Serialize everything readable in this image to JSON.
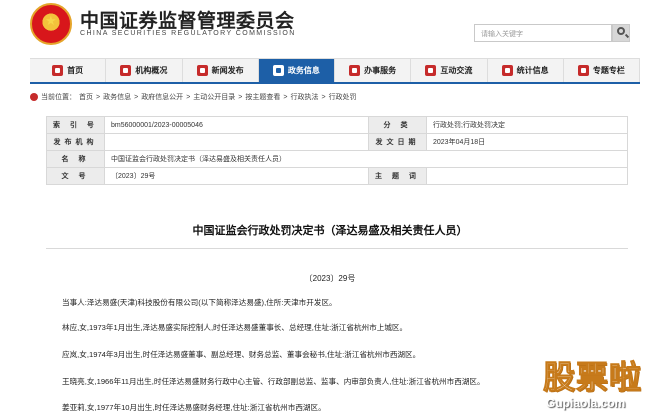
{
  "header": {
    "title": "中国证券监督管理委员会",
    "subtitle": "CHINA SECURITIES REGULATORY COMMISSION",
    "search_placeholder": "请输入关键字"
  },
  "nav": [
    {
      "label": "首页",
      "icon": "home-icon",
      "active": false
    },
    {
      "label": "机构概况",
      "icon": "building-icon",
      "active": false
    },
    {
      "label": "新闻发布",
      "icon": "news-icon",
      "active": false
    },
    {
      "label": "政务信息",
      "icon": "document-icon",
      "active": true
    },
    {
      "label": "办事服务",
      "icon": "service-icon",
      "active": false
    },
    {
      "label": "互动交流",
      "icon": "chat-icon",
      "active": false
    },
    {
      "label": "统计信息",
      "icon": "chart-icon",
      "active": false
    },
    {
      "label": "专题专栏",
      "icon": "folder-icon",
      "active": false
    }
  ],
  "breadcrumb": {
    "prefix": "当前位置：",
    "items": [
      "首页",
      "政务信息",
      "政府信息公开",
      "主动公开目录",
      "按主题查看",
      "行政执法",
      "行政处罚"
    ],
    "separator": ">"
  },
  "meta": {
    "index_label": "索 引 号",
    "index_value": "bm56000001/2023-00005046",
    "category_label": "分 类",
    "category_value": "行政处罚;行政处罚决定",
    "issuer_label": "发布机构",
    "issuer_value": "",
    "date_label": "发文日期",
    "date_value": "2023年04月18日",
    "name_label": "名 称",
    "name_value": "中国证监会行政处罚决定书（泽达易盛及相关责任人员）",
    "docno_label": "文 号",
    "docno_value": "〔2023〕29号",
    "keywords_label": "主 题 词",
    "keywords_value": ""
  },
  "document": {
    "title": "中国证监会行政处罚决定书（泽达易盛及相关责任人员）",
    "number": "〔2023〕29号",
    "paragraphs": [
      "当事人:泽达易盛(天津)科技股份有限公司(以下简称泽达易盛),住所:天津市开发区。",
      "林应,女,1973年1月出生,泽达易盛实际控制人,时任泽达易盛董事长、总经理,住址:浙江省杭州市上城区。",
      "应岚,女,1974年3月出生,时任泽达易盛董事、副总经理、财务总监、董事会秘书,住址:浙江省杭州市西湖区。",
      "王晓亮,女,1966年11月出生,时任泽达易盛财务行政中心主管、行政部副总监、监事、内审部负责人,住址:浙江省杭州市西湖区。",
      "姜亚莉,女,1977年10月出生,时任泽达易盛财务经理,住址:浙江省杭州市西湖区。"
    ]
  },
  "watermark": {
    "text": "股票啦",
    "url": "Gupiaola.com"
  }
}
